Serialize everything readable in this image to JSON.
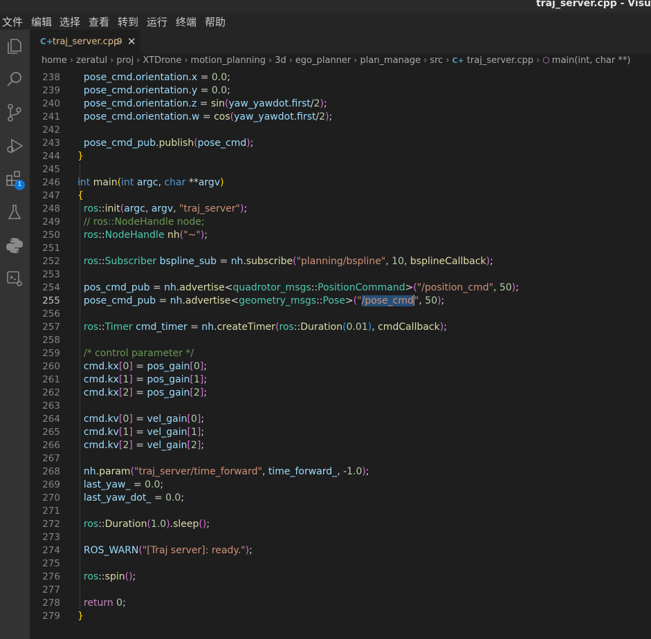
{
  "window": {
    "title": "traj_server.cpp - Visu"
  },
  "menu": [
    "文件",
    "编辑",
    "选择",
    "查看",
    "转到",
    "运行",
    "终端",
    "帮助"
  ],
  "tab": {
    "icon": "C+",
    "filename": "traj_server.cpp",
    "problems": "9"
  },
  "activity": {
    "badge": "1"
  },
  "breadcrumb": [
    "home",
    "zeratul",
    "proj",
    "XTDrone",
    "motion_planning",
    "3d",
    "ego_planner",
    "plan_manage",
    "src"
  ],
  "breadcrumb_file": "traj_server.cpp",
  "breadcrumb_symbol": "main(int, char **)",
  "active_line": 255,
  "lines": [
    {
      "n": 238,
      "toks": [
        [
          "v",
          "  pose_cmd"
        ],
        [
          "d",
          "."
        ],
        [
          "v",
          "orientation"
        ],
        [
          "d",
          "."
        ],
        [
          "v",
          "x"
        ],
        [
          "d",
          " = "
        ],
        [
          "n",
          "0.0"
        ],
        [
          "d",
          ";"
        ]
      ]
    },
    {
      "n": 239,
      "toks": [
        [
          "v",
          "  pose_cmd"
        ],
        [
          "d",
          "."
        ],
        [
          "v",
          "orientation"
        ],
        [
          "d",
          "."
        ],
        [
          "v",
          "y"
        ],
        [
          "d",
          " = "
        ],
        [
          "n",
          "0.0"
        ],
        [
          "d",
          ";"
        ]
      ]
    },
    {
      "n": 240,
      "toks": [
        [
          "v",
          "  pose_cmd"
        ],
        [
          "d",
          "."
        ],
        [
          "v",
          "orientation"
        ],
        [
          "d",
          "."
        ],
        [
          "v",
          "z"
        ],
        [
          "d",
          " = "
        ],
        [
          "f",
          "sin"
        ],
        [
          "p",
          "("
        ],
        [
          "v",
          "yaw_yawdot"
        ],
        [
          "d",
          "."
        ],
        [
          "v",
          "first"
        ],
        [
          "d",
          "/"
        ],
        [
          "n",
          "2"
        ],
        [
          "p",
          ")"
        ],
        [
          "d",
          ";"
        ]
      ]
    },
    {
      "n": 241,
      "toks": [
        [
          "v",
          "  pose_cmd"
        ],
        [
          "d",
          "."
        ],
        [
          "v",
          "orientation"
        ],
        [
          "d",
          "."
        ],
        [
          "v",
          "w"
        ],
        [
          "d",
          " = "
        ],
        [
          "f",
          "cos"
        ],
        [
          "p",
          "("
        ],
        [
          "v",
          "yaw_yawdot"
        ],
        [
          "d",
          "."
        ],
        [
          "v",
          "first"
        ],
        [
          "d",
          "/"
        ],
        [
          "n",
          "2"
        ],
        [
          "p",
          ")"
        ],
        [
          "d",
          ";"
        ]
      ]
    },
    {
      "n": 242,
      "toks": []
    },
    {
      "n": 243,
      "toks": [
        [
          "v",
          "  pose_cmd_pub"
        ],
        [
          "d",
          "."
        ],
        [
          "f",
          "publish"
        ],
        [
          "p",
          "("
        ],
        [
          "v",
          "pose_cmd"
        ],
        [
          "p",
          ")"
        ],
        [
          "d",
          ";"
        ]
      ]
    },
    {
      "n": 244,
      "toks": [
        [
          "b",
          "}"
        ]
      ]
    },
    {
      "n": 245,
      "toks": []
    },
    {
      "n": 246,
      "toks": [
        [
          "k",
          "int"
        ],
        [
          "d",
          " "
        ],
        [
          "f",
          "main"
        ],
        [
          "b",
          "("
        ],
        [
          "k",
          "int"
        ],
        [
          "d",
          " "
        ],
        [
          "v",
          "argc"
        ],
        [
          "d",
          ", "
        ],
        [
          "k",
          "char"
        ],
        [
          "d",
          " **"
        ],
        [
          "v",
          "argv"
        ],
        [
          "b",
          ")"
        ]
      ]
    },
    {
      "n": 247,
      "toks": [
        [
          "b",
          "{"
        ]
      ]
    },
    {
      "n": 248,
      "toks": [
        [
          "t",
          "  ros"
        ],
        [
          "d",
          "::"
        ],
        [
          "f",
          "init"
        ],
        [
          "p",
          "("
        ],
        [
          "v",
          "argc"
        ],
        [
          "d",
          ", "
        ],
        [
          "v",
          "argv"
        ],
        [
          "d",
          ", "
        ],
        [
          "s",
          "\"traj_server\""
        ],
        [
          "p",
          ")"
        ],
        [
          "d",
          ";"
        ]
      ]
    },
    {
      "n": 249,
      "toks": [
        [
          "c",
          "  // ros::NodeHandle node;"
        ]
      ]
    },
    {
      "n": 250,
      "toks": [
        [
          "t",
          "  ros"
        ],
        [
          "d",
          "::"
        ],
        [
          "t",
          "NodeHandle"
        ],
        [
          "d",
          " "
        ],
        [
          "f",
          "nh"
        ],
        [
          "p",
          "("
        ],
        [
          "s",
          "\"~\""
        ],
        [
          "p",
          ")"
        ],
        [
          "d",
          ";"
        ]
      ]
    },
    {
      "n": 251,
      "toks": []
    },
    {
      "n": 252,
      "toks": [
        [
          "t",
          "  ros"
        ],
        [
          "d",
          "::"
        ],
        [
          "t",
          "Subscriber"
        ],
        [
          "d",
          " "
        ],
        [
          "v",
          "bspline_sub"
        ],
        [
          "d",
          " = "
        ],
        [
          "v",
          "nh"
        ],
        [
          "d",
          "."
        ],
        [
          "f",
          "subscribe"
        ],
        [
          "p",
          "("
        ],
        [
          "s",
          "\"planning/bspline\""
        ],
        [
          "d",
          ", "
        ],
        [
          "n",
          "10"
        ],
        [
          "d",
          ", "
        ],
        [
          "f",
          "bsplineCallback"
        ],
        [
          "p",
          ")"
        ],
        [
          "d",
          ";"
        ]
      ]
    },
    {
      "n": 253,
      "toks": []
    },
    {
      "n": 254,
      "toks": [
        [
          "v",
          "  pos_cmd_pub"
        ],
        [
          "d",
          " = "
        ],
        [
          "v",
          "nh"
        ],
        [
          "d",
          "."
        ],
        [
          "f",
          "advertise"
        ],
        [
          "d",
          "<"
        ],
        [
          "t",
          "quadrotor_msgs"
        ],
        [
          "d",
          "::"
        ],
        [
          "t",
          "PositionCommand"
        ],
        [
          "d",
          ">"
        ],
        [
          "p",
          "("
        ],
        [
          "s",
          "\"/position_cmd\""
        ],
        [
          "d",
          ", "
        ],
        [
          "n",
          "50"
        ],
        [
          "p",
          ")"
        ],
        [
          "d",
          ";"
        ]
      ]
    },
    {
      "n": 255,
      "toks": [
        [
          "v",
          "  pose_cmd_pub"
        ],
        [
          "d",
          " = "
        ],
        [
          "v",
          "nh"
        ],
        [
          "d",
          "."
        ],
        [
          "f",
          "advertise"
        ],
        [
          "d",
          "<"
        ],
        [
          "t",
          "geometry_msgs"
        ],
        [
          "d",
          "::"
        ],
        [
          "t",
          "Pose"
        ],
        [
          "d",
          ">"
        ],
        [
          "p",
          "("
        ],
        [
          "s",
          "\""
        ],
        [
          "sel",
          "/pose_cmd"
        ],
        [
          "cur",
          ""
        ],
        [
          "s",
          "\""
        ],
        [
          "d",
          ", "
        ],
        [
          "n",
          "50"
        ],
        [
          "p",
          ")"
        ],
        [
          "d",
          ";"
        ]
      ]
    },
    {
      "n": 256,
      "toks": []
    },
    {
      "n": 257,
      "toks": [
        [
          "t",
          "  ros"
        ],
        [
          "d",
          "::"
        ],
        [
          "t",
          "Timer"
        ],
        [
          "d",
          " "
        ],
        [
          "v",
          "cmd_timer"
        ],
        [
          "d",
          " = "
        ],
        [
          "v",
          "nh"
        ],
        [
          "d",
          "."
        ],
        [
          "f",
          "createTimer"
        ],
        [
          "p",
          "("
        ],
        [
          "t",
          "ros"
        ],
        [
          "d",
          "::"
        ],
        [
          "f",
          "Duration"
        ],
        [
          "o",
          "("
        ],
        [
          "n",
          "0.01"
        ],
        [
          "o",
          ")"
        ],
        [
          "d",
          ", "
        ],
        [
          "f",
          "cmdCallback"
        ],
        [
          "p",
          ")"
        ],
        [
          "d",
          ";"
        ]
      ]
    },
    {
      "n": 258,
      "toks": []
    },
    {
      "n": 259,
      "toks": [
        [
          "c",
          "  /* control parameter */"
        ]
      ]
    },
    {
      "n": 260,
      "toks": [
        [
          "v",
          "  cmd"
        ],
        [
          "d",
          "."
        ],
        [
          "v",
          "kx"
        ],
        [
          "p",
          "["
        ],
        [
          "n",
          "0"
        ],
        [
          "p",
          "]"
        ],
        [
          "d",
          " = "
        ],
        [
          "v",
          "pos_gain"
        ],
        [
          "p",
          "["
        ],
        [
          "n",
          "0"
        ],
        [
          "p",
          "]"
        ],
        [
          "d",
          ";"
        ]
      ]
    },
    {
      "n": 261,
      "toks": [
        [
          "v",
          "  cmd"
        ],
        [
          "d",
          "."
        ],
        [
          "v",
          "kx"
        ],
        [
          "p",
          "["
        ],
        [
          "n",
          "1"
        ],
        [
          "p",
          "]"
        ],
        [
          "d",
          " = "
        ],
        [
          "v",
          "pos_gain"
        ],
        [
          "p",
          "["
        ],
        [
          "n",
          "1"
        ],
        [
          "p",
          "]"
        ],
        [
          "d",
          ";"
        ]
      ]
    },
    {
      "n": 262,
      "toks": [
        [
          "v",
          "  cmd"
        ],
        [
          "d",
          "."
        ],
        [
          "v",
          "kx"
        ],
        [
          "p",
          "["
        ],
        [
          "n",
          "2"
        ],
        [
          "p",
          "]"
        ],
        [
          "d",
          " = "
        ],
        [
          "v",
          "pos_gain"
        ],
        [
          "p",
          "["
        ],
        [
          "n",
          "2"
        ],
        [
          "p",
          "]"
        ],
        [
          "d",
          ";"
        ]
      ]
    },
    {
      "n": 263,
      "toks": []
    },
    {
      "n": 264,
      "toks": [
        [
          "v",
          "  cmd"
        ],
        [
          "d",
          "."
        ],
        [
          "v",
          "kv"
        ],
        [
          "p",
          "["
        ],
        [
          "n",
          "0"
        ],
        [
          "p",
          "]"
        ],
        [
          "d",
          " = "
        ],
        [
          "v",
          "vel_gain"
        ],
        [
          "p",
          "["
        ],
        [
          "n",
          "0"
        ],
        [
          "p",
          "]"
        ],
        [
          "d",
          ";"
        ]
      ]
    },
    {
      "n": 265,
      "toks": [
        [
          "v",
          "  cmd"
        ],
        [
          "d",
          "."
        ],
        [
          "v",
          "kv"
        ],
        [
          "p",
          "["
        ],
        [
          "n",
          "1"
        ],
        [
          "p",
          "]"
        ],
        [
          "d",
          " = "
        ],
        [
          "v",
          "vel_gain"
        ],
        [
          "p",
          "["
        ],
        [
          "n",
          "1"
        ],
        [
          "p",
          "]"
        ],
        [
          "d",
          ";"
        ]
      ]
    },
    {
      "n": 266,
      "toks": [
        [
          "v",
          "  cmd"
        ],
        [
          "d",
          "."
        ],
        [
          "v",
          "kv"
        ],
        [
          "p",
          "["
        ],
        [
          "n",
          "2"
        ],
        [
          "p",
          "]"
        ],
        [
          "d",
          " = "
        ],
        [
          "v",
          "vel_gain"
        ],
        [
          "p",
          "["
        ],
        [
          "n",
          "2"
        ],
        [
          "p",
          "]"
        ],
        [
          "d",
          ";"
        ]
      ]
    },
    {
      "n": 267,
      "toks": []
    },
    {
      "n": 268,
      "toks": [
        [
          "v",
          "  nh"
        ],
        [
          "d",
          "."
        ],
        [
          "f",
          "param"
        ],
        [
          "p",
          "("
        ],
        [
          "s",
          "\"traj_server/time_forward\""
        ],
        [
          "d",
          ", "
        ],
        [
          "v",
          "time_forward_"
        ],
        [
          "d",
          ", -"
        ],
        [
          "n",
          "1.0"
        ],
        [
          "p",
          ")"
        ],
        [
          "d",
          ";"
        ]
      ]
    },
    {
      "n": 269,
      "toks": [
        [
          "v",
          "  last_yaw_"
        ],
        [
          "d",
          " = "
        ],
        [
          "n",
          "0.0"
        ],
        [
          "d",
          ";"
        ]
      ]
    },
    {
      "n": 270,
      "toks": [
        [
          "v",
          "  last_yaw_dot_"
        ],
        [
          "d",
          " = "
        ],
        [
          "n",
          "0.0"
        ],
        [
          "d",
          ";"
        ]
      ]
    },
    {
      "n": 271,
      "toks": []
    },
    {
      "n": 272,
      "toks": [
        [
          "t",
          "  ros"
        ],
        [
          "d",
          "::"
        ],
        [
          "f",
          "Duration"
        ],
        [
          "p",
          "("
        ],
        [
          "n",
          "1.0"
        ],
        [
          "p",
          ")"
        ],
        [
          "d",
          "."
        ],
        [
          "f",
          "sleep"
        ],
        [
          "p",
          "()"
        ],
        [
          "d",
          ";"
        ]
      ]
    },
    {
      "n": 273,
      "toks": []
    },
    {
      "n": 274,
      "toks": [
        [
          "v",
          "  ROS_WARN"
        ],
        [
          "p",
          "("
        ],
        [
          "s",
          "\"[Traj server]: ready.\""
        ],
        [
          "p",
          ")"
        ],
        [
          "d",
          ";"
        ]
      ]
    },
    {
      "n": 275,
      "toks": []
    },
    {
      "n": 276,
      "toks": [
        [
          "t",
          "  ros"
        ],
        [
          "d",
          "::"
        ],
        [
          "f",
          "spin"
        ],
        [
          "p",
          "()"
        ],
        [
          "d",
          ";"
        ]
      ]
    },
    {
      "n": 277,
      "toks": []
    },
    {
      "n": 278,
      "toks": [
        [
          "r",
          "  return"
        ],
        [
          "d",
          " "
        ],
        [
          "n",
          "0"
        ],
        [
          "d",
          ";"
        ]
      ]
    },
    {
      "n": 279,
      "toks": [
        [
          "b",
          "}"
        ]
      ]
    }
  ]
}
